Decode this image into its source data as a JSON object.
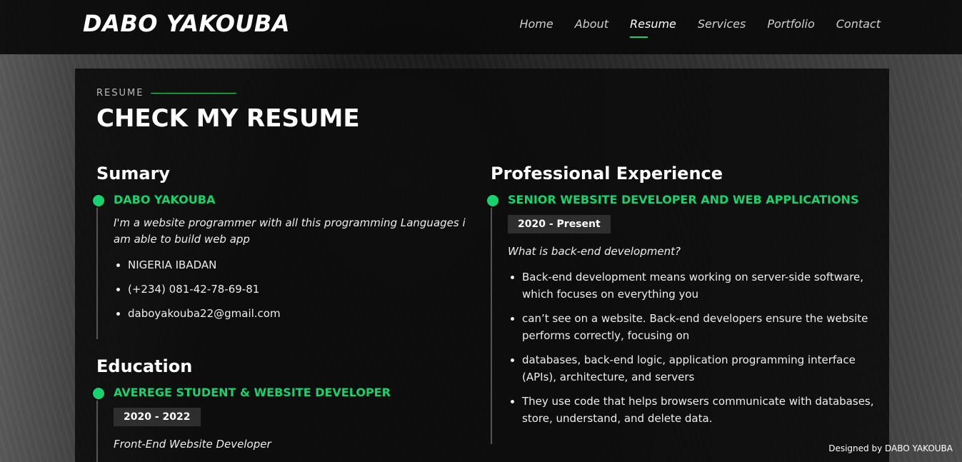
{
  "brand": "DABO YAKOUBA",
  "nav": [
    "Home",
    "About",
    "Resume",
    "Services",
    "Portfolio",
    "Contact"
  ],
  "section": {
    "eyebrow": "RESUME",
    "title": "CHECK MY RESUME"
  },
  "summary": {
    "heading": "Sumary",
    "name": "DABO YAKOUBA",
    "description": "I'm a website programmer with all this programming Languages i am able to build web app",
    "details": [
      "NIGERIA IBADAN",
      "(+234) 081-42-78-69-81",
      "daboyakouba22@gmail.com"
    ]
  },
  "education": {
    "heading": "Education",
    "title": "AVEREGE STUDENT & WEBSITE DEVELOPER",
    "date": "2020 - 2022",
    "subtitle": "Front-End Website Developer"
  },
  "experience": {
    "heading": "Professional Experience",
    "title": "SENIOR WEBSITE DEVELOPER AND WEB APPLICATIONS",
    "date": "2020 - Present",
    "question": "What is back-end development?",
    "points": [
      "Back-end development means working on server-side software, which focuses on everything you",
      "can’t see on a website. Back-end developers ensure the website performs correctly, focusing on",
      "databases, back-end logic, application programming interface (APIs), architecture, and servers",
      "They use code that helps browsers communicate with databases, store, understand, and delete data."
    ]
  },
  "footer": "Designed by DABO YAKOUBA",
  "colors": {
    "accent": "#18d26e"
  }
}
